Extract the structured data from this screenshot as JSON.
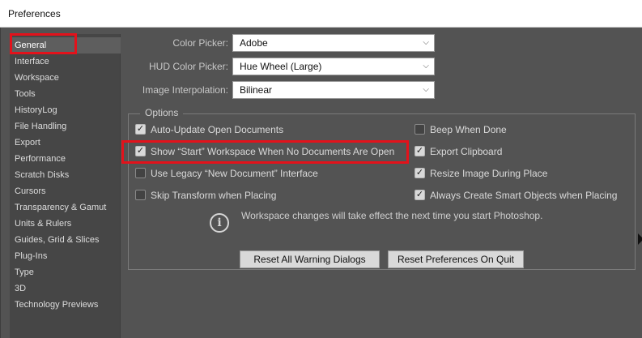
{
  "window": {
    "title": "Preferences"
  },
  "sidebar": {
    "items": [
      {
        "label": "General",
        "selected": true
      },
      {
        "label": "Interface"
      },
      {
        "label": "Workspace"
      },
      {
        "label": "Tools"
      },
      {
        "label": "HistoryLog"
      },
      {
        "label": "File Handling"
      },
      {
        "label": "Export"
      },
      {
        "label": "Performance"
      },
      {
        "label": "Scratch Disks"
      },
      {
        "label": "Cursors"
      },
      {
        "label": "Transparency & Gamut"
      },
      {
        "label": "Units & Rulers"
      },
      {
        "label": "Guides, Grid & Slices"
      },
      {
        "label": "Plug-Ins"
      },
      {
        "label": "Type"
      },
      {
        "label": "3D"
      },
      {
        "label": "Technology Previews"
      }
    ]
  },
  "fields": {
    "color_picker": {
      "label": "Color Picker:",
      "value": "Adobe"
    },
    "hud_color_picker": {
      "label": "HUD Color Picker:",
      "value": "Hue Wheel (Large)"
    },
    "image_interpolation": {
      "label": "Image Interpolation:",
      "value": "Bilinear"
    }
  },
  "options": {
    "legend": "Options",
    "left": [
      {
        "label": "Auto-Update Open Documents",
        "checked": true
      },
      {
        "label": "Show “Start” Workspace When No Documents Are Open",
        "checked": true
      },
      {
        "label": "Use Legacy “New Document” Interface",
        "checked": false
      },
      {
        "label": "Skip Transform when Placing",
        "checked": false
      }
    ],
    "right": [
      {
        "label": "Beep When Done",
        "checked": false
      },
      {
        "label": "Export Clipboard",
        "checked": true
      },
      {
        "label": "Resize Image During Place",
        "checked": true
      },
      {
        "label": "Always Create Smart Objects when Placing",
        "checked": true
      }
    ],
    "info": "Workspace changes will take effect the next time you start Photoshop."
  },
  "buttons": {
    "reset_warnings": "Reset All Warning Dialogs",
    "reset_prefs": "Reset Preferences On Quit"
  },
  "glyphs": {
    "check": "✓",
    "chevron": "⌵",
    "info": "i"
  },
  "colors": {
    "highlight_box": "#e3121b",
    "panel_bg": "#535353",
    "sidebar_bg": "#464646"
  }
}
